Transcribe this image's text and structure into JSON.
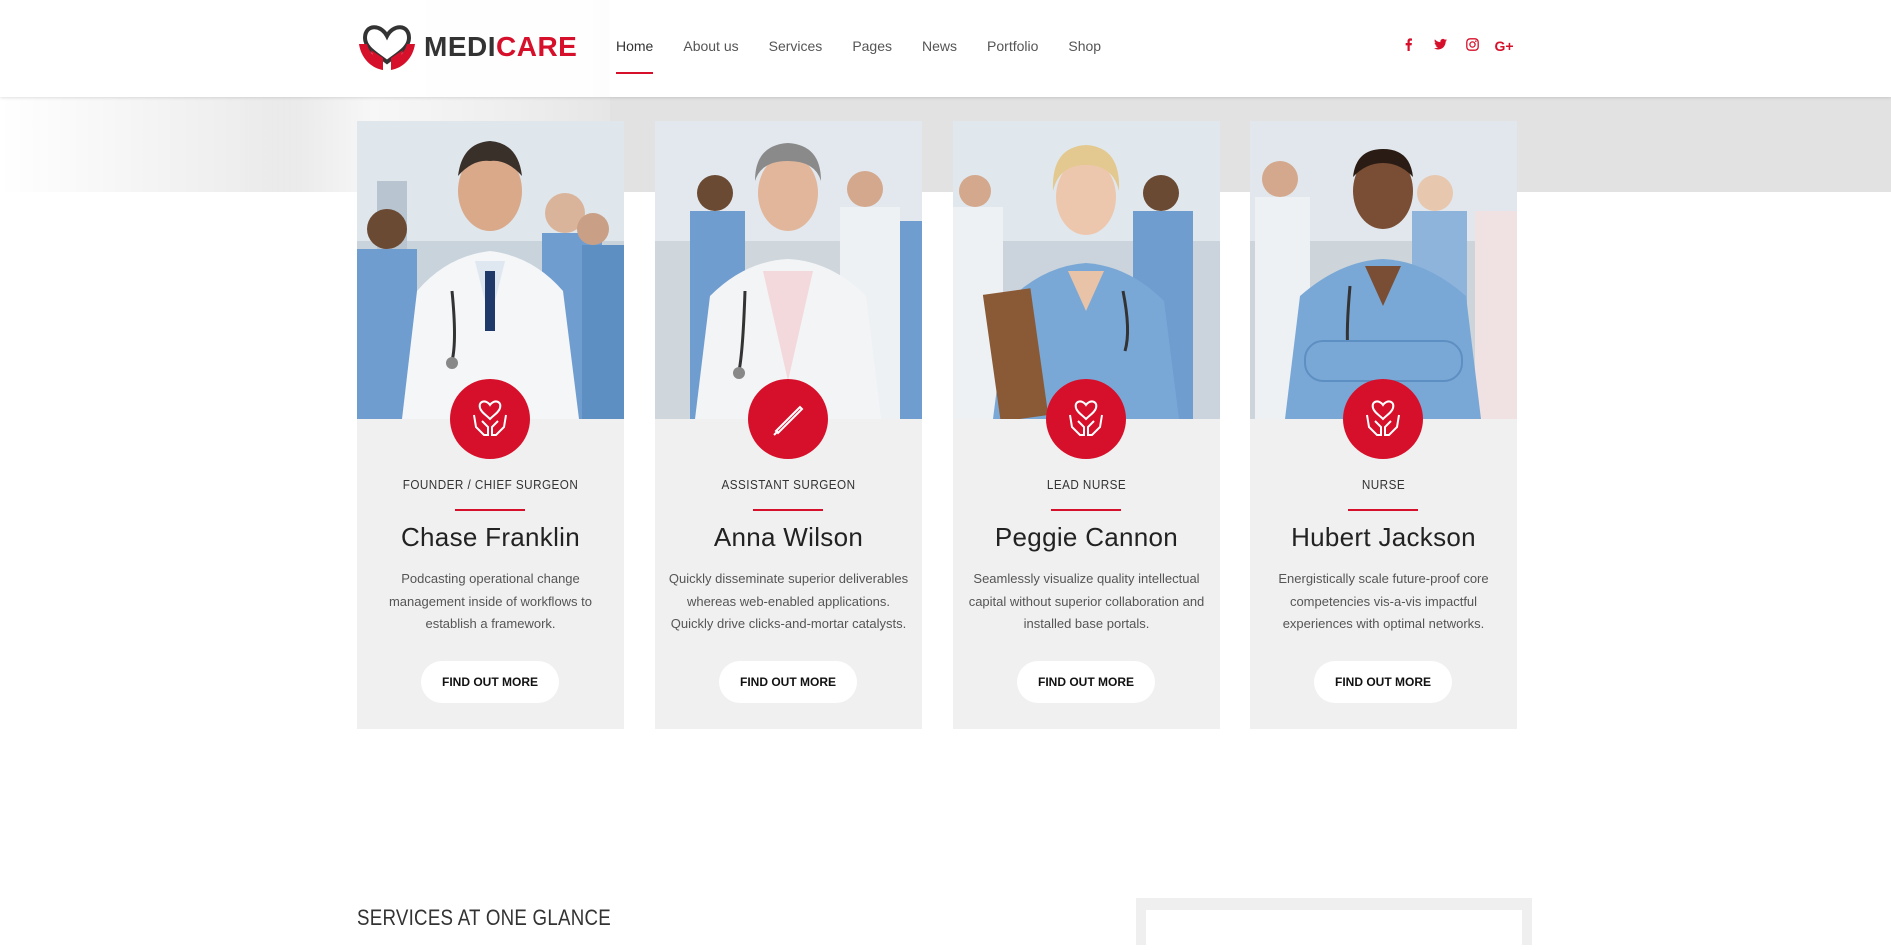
{
  "brand": {
    "part1": "MEDI",
    "part2": "CARE",
    "accent": "#d6102a"
  },
  "nav": {
    "items": [
      {
        "label": "Home",
        "active": true
      },
      {
        "label": "About us"
      },
      {
        "label": "Services"
      },
      {
        "label": "Pages"
      },
      {
        "label": "News"
      },
      {
        "label": "Portfolio"
      },
      {
        "label": "Shop"
      }
    ]
  },
  "social": [
    {
      "name": "facebook-icon",
      "glyph": "f"
    },
    {
      "name": "twitter-icon",
      "glyph": "t"
    },
    {
      "name": "instagram-icon",
      "glyph": "o"
    },
    {
      "name": "google-plus-icon",
      "glyph": "G+"
    }
  ],
  "team": [
    {
      "role": "FOUNDER / CHIEF SURGEON",
      "name": "Chase Franklin",
      "desc": "Podcasting operational change management inside of workflows to establish a framework.",
      "button": "FIND OUT MORE",
      "icon": "caring-hands-icon"
    },
    {
      "role": "ASSISTANT SURGEON",
      "name": "Anna Wilson",
      "desc": "Quickly disseminate superior deliverables whereas web-enabled applications. Quickly drive clicks-and-mortar catalysts.",
      "button": "FIND OUT MORE",
      "icon": "scalpel-icon"
    },
    {
      "role": "LEAD NURSE",
      "name": "Peggie Cannon",
      "desc": "Seamlessly visualize quality intellectual capital without superior collaboration and installed base portals.",
      "button": "FIND OUT MORE",
      "icon": "caring-hands-icon"
    },
    {
      "role": "NURSE",
      "name": "Hubert Jackson",
      "desc": "Energistically scale future-proof core competencies vis-a-vis impactful experiences with optimal networks.",
      "button": "FIND OUT MORE",
      "icon": "caring-hands-icon"
    }
  ],
  "services_title": "SERVICES AT ONE GLANCE"
}
